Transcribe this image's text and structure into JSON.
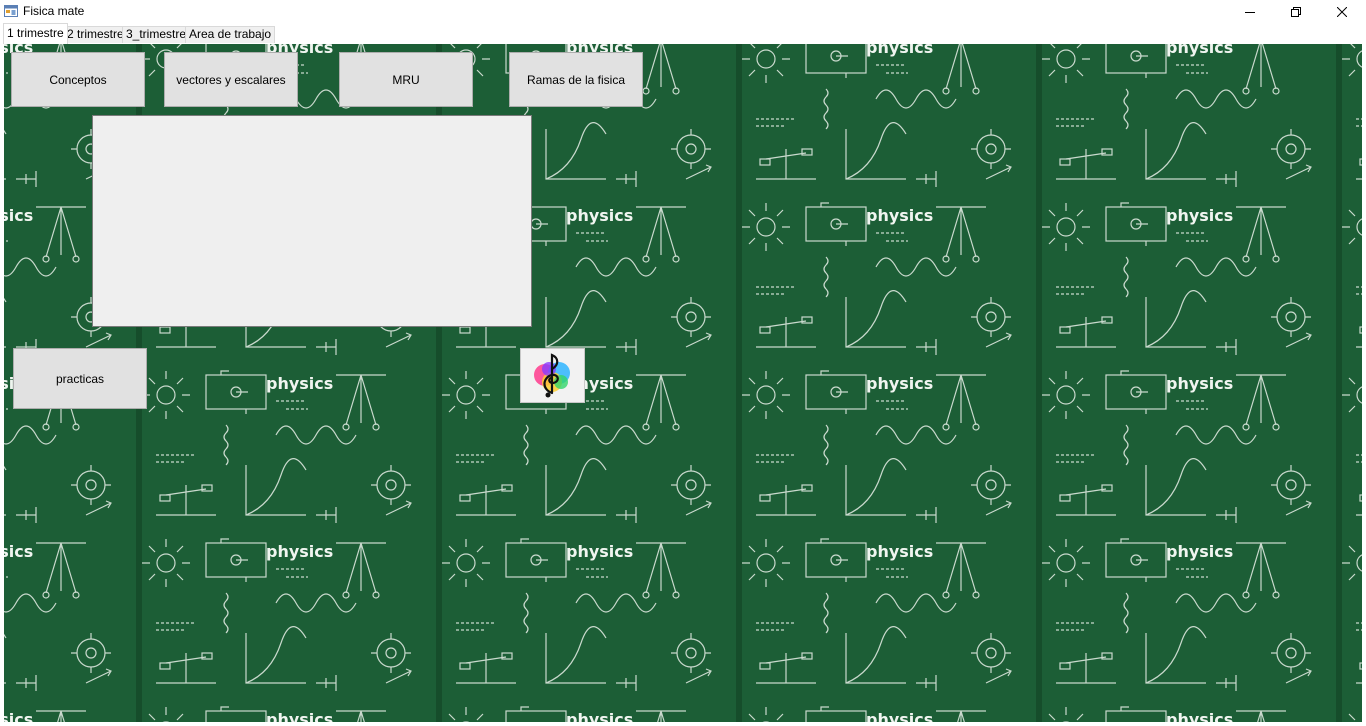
{
  "window": {
    "title": "Fisica mate",
    "app_icon": "app-form-icon",
    "controls": [
      "minimize-icon",
      "restore-icon",
      "close-icon"
    ]
  },
  "tabs": [
    {
      "label": "1 trimestre",
      "active": true
    },
    {
      "label": "2 trimestre",
      "active": false
    },
    {
      "label": "3_trimestre",
      "active": false
    },
    {
      "label": "Area de trabajo",
      "active": false
    }
  ],
  "background": {
    "wallpaper_text": "physics",
    "board_color": "#1c5e36",
    "chalk_color": "#e8efe8"
  },
  "buttons": {
    "conceptos": "Conceptos",
    "vectores": "vectores y escalares",
    "mru": "MRU",
    "ramas": "Ramas de la fisica",
    "practicas": "practicas"
  },
  "content_box": {
    "value": ""
  },
  "music_button": {
    "icon": "music-note-icon"
  }
}
